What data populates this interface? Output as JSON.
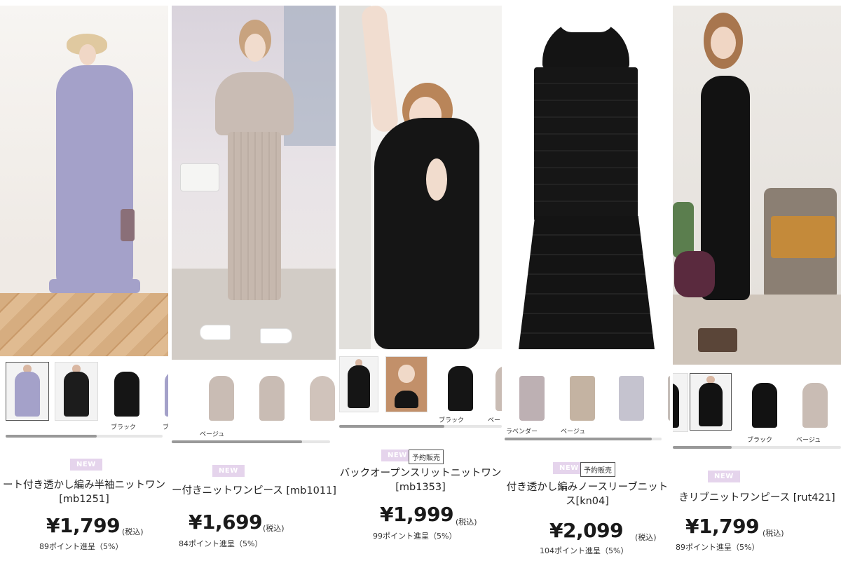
{
  "columns": [
    {
      "thumb_labels": [
        "",
        "",
        "ブラック",
        "ブ"
      ],
      "badges": {
        "new": "NEW",
        "preorder": ""
      },
      "name_line1": "ート付き透かし編み半袖ニットワン",
      "name_line2": "[mb1251]",
      "price": "¥1,799",
      "tax": "(税込)",
      "points": "89ポイント進呈（5%）",
      "colors": {
        "dress": "#a4a1c9",
        "bg": "#f4f1ee",
        "floor": "#d9b48a"
      }
    },
    {
      "thumb_labels": [
        "",
        "ベージュ",
        "",
        ""
      ],
      "badges": {
        "new": "NEW",
        "preorder": ""
      },
      "name_line1": "ー付きニットワンピース [mb1011]",
      "name_line2": "",
      "price": "¥1,699",
      "tax": "(税込)",
      "points": "84ポイント進呈（5%）",
      "colors": {
        "dress": "#c9bcb4",
        "bg": "#e6e1e6",
        "floor": "#cfc8c1"
      }
    },
    {
      "thumb_labels": [
        "",
        "",
        "ブラック",
        "ベー"
      ],
      "badges": {
        "new": "NEW",
        "preorder": "予約販売"
      },
      "name_line1": "バックオープンスリットニットワン",
      "name_line2": "[mb1353]",
      "price": "¥1,999",
      "tax": "(税込)",
      "points": "99ポイント進呈（5%）",
      "colors": {
        "dress": "#151515",
        "bg": "#efeeec",
        "floor": "#e6e3df"
      }
    },
    {
      "thumb_labels": [
        "ラベンダー",
        "ベージュ",
        "",
        ""
      ],
      "badges": {
        "new": "NEW",
        "preorder": "予約販売"
      },
      "name_line1": "付き透かし編みノースリーブニット",
      "name_line2": "ス[kn04]",
      "price": "¥2,099",
      "tax": "(税込)",
      "points": "104ポイント進呈（5%）",
      "colors": {
        "dress": "#111111",
        "bg": "#ffffff",
        "floor": "#ffffff"
      }
    },
    {
      "thumb_labels": [
        "",
        "",
        "ブラック",
        "ベージュ"
      ],
      "badges": {
        "new": "NEW",
        "preorder": ""
      },
      "name_line1": "きリブニットワンピース [rut421]",
      "name_line2": "",
      "price": "¥1,799",
      "tax": "(税込)",
      "points": "89ポイント進呈（5%）",
      "colors": {
        "dress": "#121212",
        "bg": "#e9e6e2",
        "floor": "#8b7f73"
      }
    }
  ]
}
